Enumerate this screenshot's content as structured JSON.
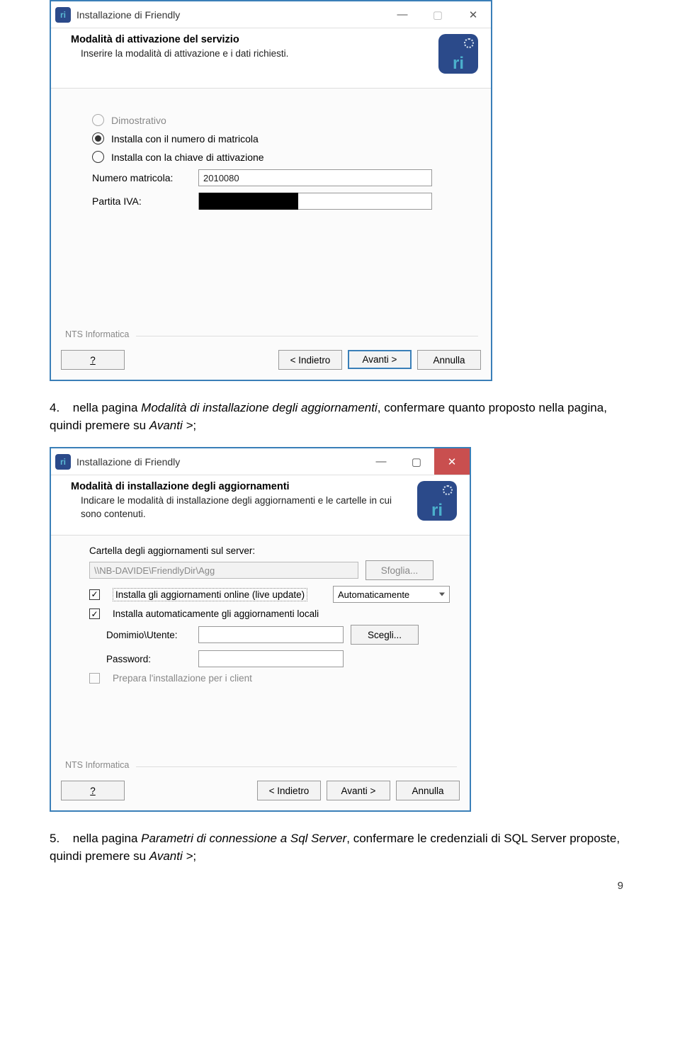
{
  "dialog1": {
    "title": "Installazione di Friendly",
    "bannerTitle": "Modalità di attivazione del servizio",
    "bannerSub": "Inserire la modalità di attivazione e i dati richiesti.",
    "optDemo": "Dimostrativo",
    "optMatricola": "Installa con il numero di matricola",
    "optChiave": "Installa con la chiave di attivazione",
    "lblMatricola": "Numero matricola:",
    "valMatricola": "2010080",
    "lblPiva": "Partita IVA:",
    "footer": "NTS Informatica",
    "btnHelp": "?",
    "btnBack": "< Indietro",
    "btnNext": "Avanti >",
    "btnCancel": "Annulla"
  },
  "doc1": {
    "num": "4.",
    "text_a": "nella pagina ",
    "text_i": "Modalità di installazione degli aggiornamenti",
    "text_b": ", confermare quanto proposto nella pagina, quindi premere su ",
    "text_c": "Avanti >",
    "text_d": ";"
  },
  "dialog2": {
    "title": "Installazione di Friendly",
    "bannerTitle": "Modalità di installazione degli aggiornamenti",
    "bannerSub": "Indicare le modalità di installazione degli aggiornamenti e le cartelle in cui sono contenuti.",
    "lblCartella": "Cartella degli aggiornamenti sul server:",
    "valCartella": "\\\\NB-DAVIDE\\FriendlyDir\\Agg",
    "btnSfoglia": "Sfoglia...",
    "chkOnline": "Installa gli aggiornamenti online (live update)",
    "selMode": "Automaticamente",
    "chkLocal": "Installa automaticamente gli aggiornamenti locali",
    "lblDom": "Domimio\\Utente:",
    "lblPwd": "Password:",
    "btnScegli": "Scegli...",
    "chkClient": "Prepara l'installazione per i client",
    "footer": "NTS Informatica",
    "btnHelp": "?",
    "btnBack": "< Indietro",
    "btnNext": "Avanti >",
    "btnCancel": "Annulla"
  },
  "doc2": {
    "num": "5.",
    "text_a": "nella pagina ",
    "text_i": "Parametri di connessione a Sql Server",
    "text_b": ", confermare le credenziali di SQL Server proposte, quindi premere su ",
    "text_c": "Avanti >",
    "text_d": ";"
  },
  "pageNumber": "9"
}
